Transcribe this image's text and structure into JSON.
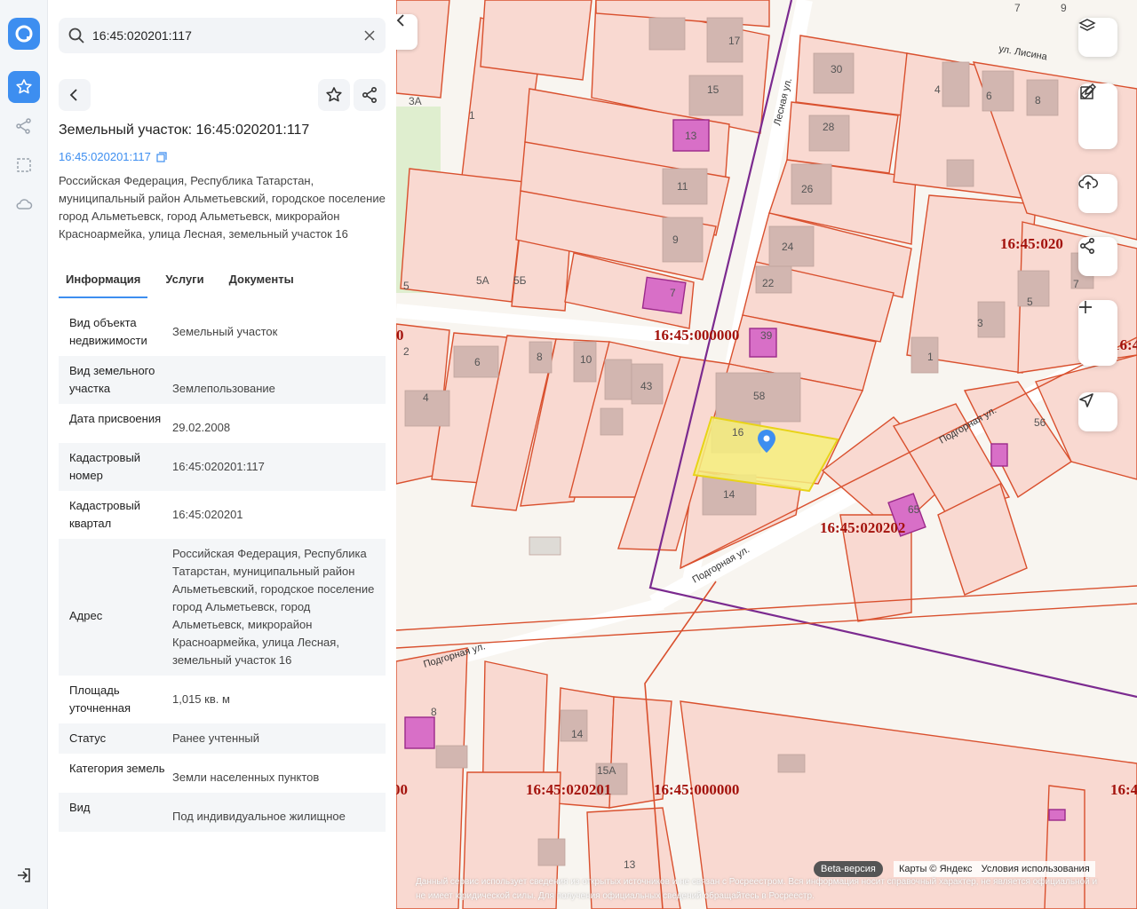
{
  "search": {
    "value": "16:45:020201:117"
  },
  "object": {
    "title": "Земельный участок: 16:45:020201:117",
    "cadastral_link": "16:45:020201:117",
    "address": "Российская Федерация, Республика Татарстан, муниципальный район Альметьевский, городское поселение город Альметьевск, город Альметьевск, микрорайон Красноармейка, улица Лесная, земельный участок 16"
  },
  "tabs": [
    {
      "label": "Информация",
      "active": true
    },
    {
      "label": "Услуги",
      "active": false
    },
    {
      "label": "Документы",
      "active": false
    }
  ],
  "info_rows": [
    {
      "key": "Вид объекта недвижимости",
      "value": "Земельный участок"
    },
    {
      "key": "Вид земельного участка",
      "value": "Землепользование"
    },
    {
      "key": "Дата присвоения",
      "value": "29.02.2008"
    },
    {
      "key": "Кадастровый номер",
      "value": "16:45:020201:117"
    },
    {
      "key": "Кадастровый квартал",
      "value": "16:45:020201"
    },
    {
      "key": "Адрес",
      "value": "Российская Федерация, Республика Татарстан, муниципальный район Альметьевский, городское поселение город Альметьевск, город Альметьевск, микрорайон Красноармейка, улица Лесная, земельный участок 16"
    },
    {
      "key": "Площадь уточненная",
      "value": "1,015 кв. м"
    },
    {
      "key": "Статус",
      "value": "Ранее учтенный"
    },
    {
      "key": "Категория земель",
      "value": "Земли населенных пунктов"
    },
    {
      "key": "Вид",
      "value": "Под индивидуальное жилищное"
    }
  ],
  "map": {
    "streets": [
      "ул. Лисина",
      "Лесная ул.",
      "Подгорная ул.",
      "Подгорная ул.",
      "Подгорная ул."
    ],
    "quarters": [
      "16:45:000000",
      "16:45:020202",
      "16:45:020201",
      "16:45:000000",
      "16:45:020",
      "16:45",
      "16:4",
      "00",
      "0"
    ],
    "lot_numbers": [
      "3А",
      "1",
      "5",
      "5А",
      "5Б",
      "17",
      "15",
      "13",
      "11",
      "9",
      "7",
      "30",
      "28",
      "26",
      "24",
      "22",
      "39",
      "58",
      "16",
      "14",
      "4",
      "6",
      "8",
      "3",
      "5",
      "7",
      "1",
      "56",
      "65",
      "2",
      "4",
      "6",
      "8",
      "10",
      "43",
      "8",
      "14",
      "15А",
      "13",
      "9",
      "7"
    ],
    "badge": "Beta-версия",
    "credits": [
      "Карты © Яндекс",
      "Условия использования"
    ],
    "disclaimer": "Данный сервис использует сведения из открытых источников и не связан с Росреестром. Вся информация носит справочный характер, не является официальной и не имеет юридической силы. Для получения официальных сведений обращайтесь в Росреестр.",
    "colors": {
      "parcel_fill": "#f9d9d1",
      "parcel_stroke": "#d9502e",
      "selected_fill": "#f6ee7e",
      "quarter_line": "#7b2a8f",
      "building": "#d2b6b0",
      "oks": "#d86fc7",
      "quarter_label": "#a3120c",
      "accent": "#3d8ef0"
    }
  }
}
